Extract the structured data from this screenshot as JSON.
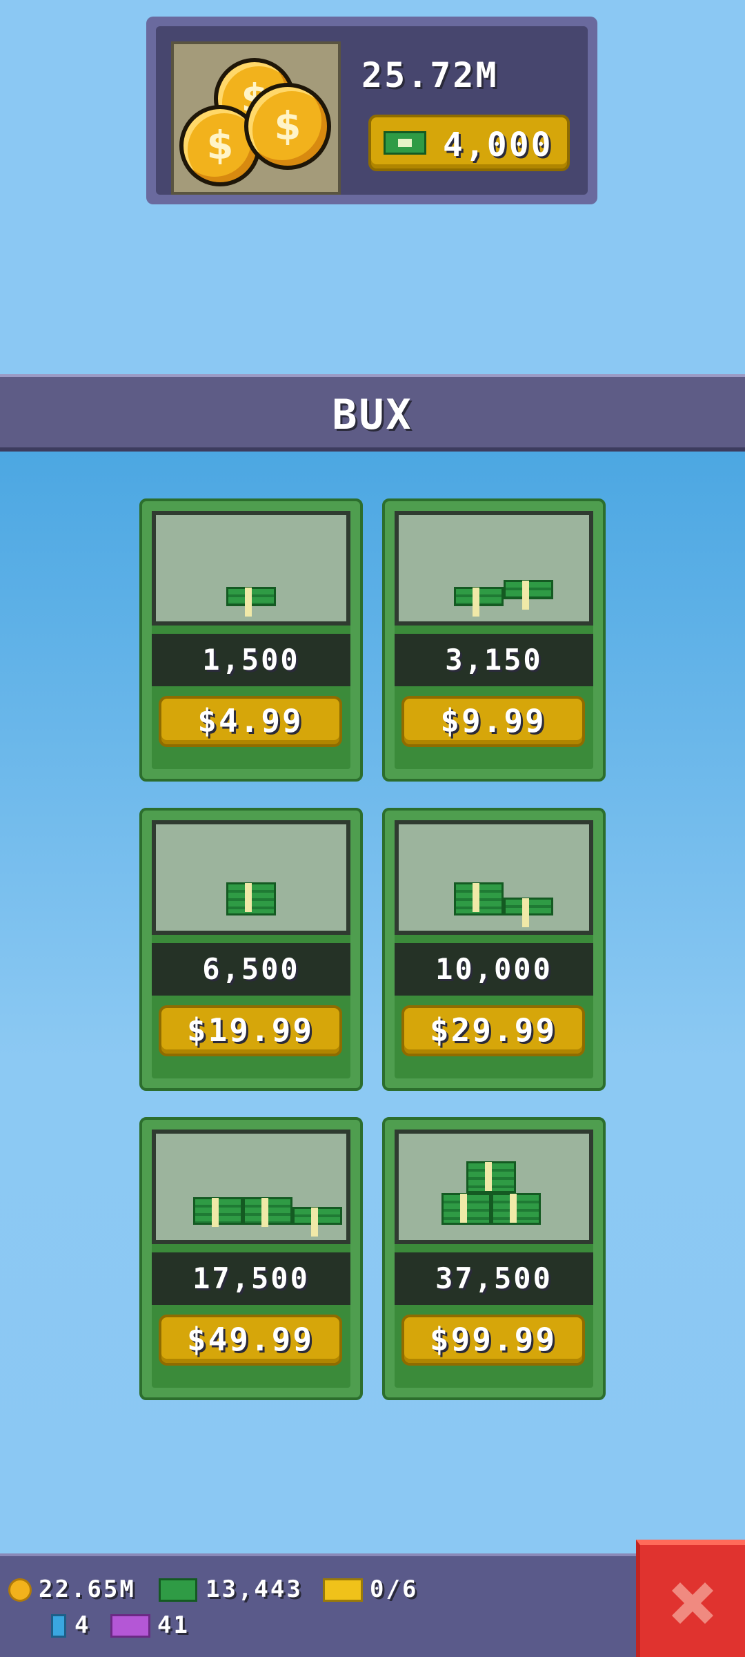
{
  "balances": {
    "coins": "25.72M",
    "bux": "4,000"
  },
  "header": {
    "title": "BUX"
  },
  "packs": [
    {
      "amount": "1,500",
      "price": "$4.99"
    },
    {
      "amount": "3,150",
      "price": "$9.99"
    },
    {
      "amount": "6,500",
      "price": "$19.99"
    },
    {
      "amount": "10,000",
      "price": "$29.99"
    },
    {
      "amount": "17,500",
      "price": "$49.99"
    },
    {
      "amount": "37,500",
      "price": "$99.99"
    }
  ],
  "bottom_bar": {
    "coins": "22.65M",
    "bux": "13,443",
    "tickets": "0/6",
    "elevator_passes": "4",
    "vip_tickets": "41"
  },
  "icons": {
    "coin": "coin-stack-icon",
    "bux": "bux-bill-icon",
    "ticket": "ticket-icon",
    "vip": "vip-ticket-icon",
    "close": "close-x-icon"
  },
  "colors": {
    "sky": "#8bc8f3",
    "panel": "#47466e",
    "button_gold": "#d6a60a",
    "card_green": "#4f9e4f",
    "close_red": "#e0332f"
  }
}
